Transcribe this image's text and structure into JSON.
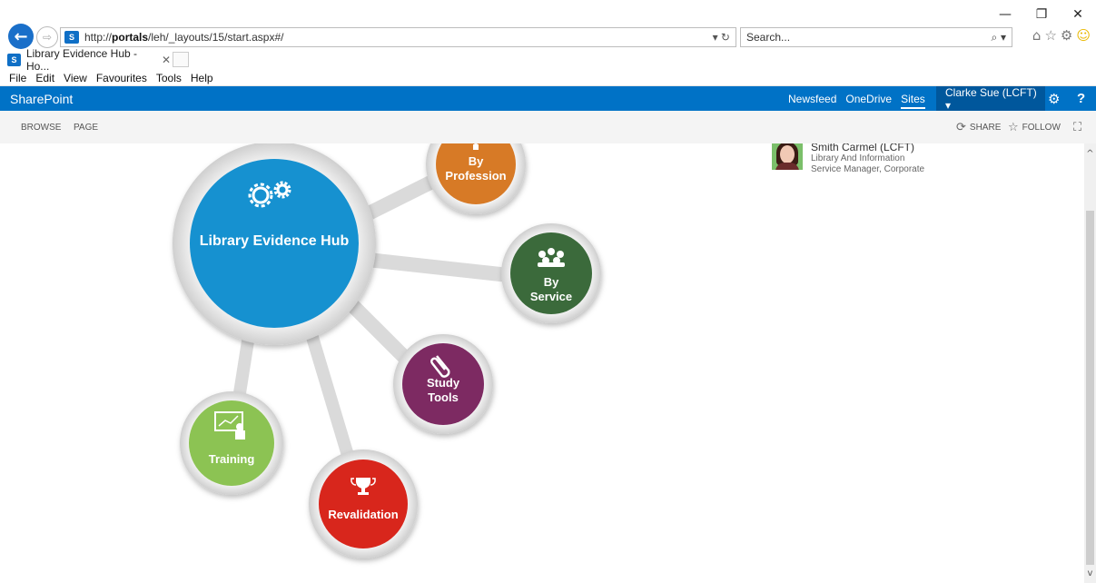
{
  "window": {
    "minimize_glyph": "—",
    "restore_glyph": "❐",
    "close_glyph": "✕"
  },
  "browser": {
    "back_glyph": "←",
    "forward_glyph": "⇨",
    "url_prefix": "http://",
    "url_host": "portals",
    "url_path": "/leh/_layouts/15/start.aspx#/",
    "address_right": "▾ ↻",
    "search_placeholder": "Search...",
    "search_icon": "⌕ ▾",
    "toolbar_icons": [
      "home-icon",
      "star-icon",
      "gear-icon",
      "smiley-icon"
    ],
    "home_glyph": "⌂",
    "star_glyph": "☆",
    "gear_glyph": "⚙",
    "smile_glyph": "☺",
    "favicon_text": "S",
    "tab_title": "Library Evidence Hub - Ho...",
    "tab_close": "✕"
  },
  "menu": [
    "File",
    "Edit",
    "View",
    "Favourites",
    "Tools",
    "Help"
  ],
  "suite": {
    "brand": "SharePoint",
    "links": [
      "Newsfeed",
      "OneDrive",
      "Sites"
    ],
    "active_link": "Sites",
    "user": "Clarke Sue (LCFT) ▾",
    "gear_glyph": "⚙",
    "help_glyph": "?",
    "color": "#0072c6"
  },
  "ribbon": {
    "tabs": [
      "BROWSE",
      "PAGE"
    ],
    "share_label": "SHARE",
    "follow_label": "FOLLOW",
    "share_glyph": "⟳",
    "follow_glyph": "☆",
    "focus_glyph": "⛶"
  },
  "hub": {
    "center_label": "Library Evidence Hub",
    "center_icon": "gears-icon",
    "nodes": [
      {
        "label_lines": [
          "By",
          "Profession"
        ],
        "color": "#d77a28",
        "icon": "person-icon"
      },
      {
        "label_lines": [
          "By",
          "Service"
        ],
        "color": "#3b6b3b",
        "icon": "group-icon"
      },
      {
        "label_lines": [
          "Study",
          "Tools"
        ],
        "color": "#7d2b62",
        "icon": "paperclip-icon"
      },
      {
        "label_lines": [
          "Training"
        ],
        "color": "#8cc352",
        "icon": "presentation-icon"
      },
      {
        "label_lines": [
          "Revalidation"
        ],
        "color": "#d8261f",
        "icon": "trophy-icon"
      }
    ],
    "center_color": "#1691d0"
  },
  "person": {
    "name": "Smith Carmel (LCFT)",
    "role_line1": "Library And Information",
    "role_line2": "Service Manager, Corporate"
  },
  "scroll": {
    "up_glyph": "^",
    "down_glyph": "v"
  }
}
